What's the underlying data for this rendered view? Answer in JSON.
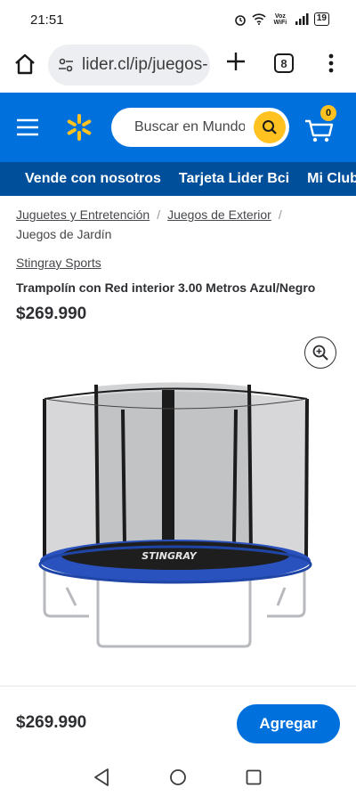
{
  "status_bar": {
    "time": "21:51",
    "network_label": "Voz WiFi",
    "battery": "19"
  },
  "browser": {
    "url": "lider.cl/ip/juegos-",
    "tab_count": "8"
  },
  "header": {
    "search_placeholder": "Buscar en Mundo Lider",
    "cart_count": "0"
  },
  "sub_nav": {
    "items": [
      "Vende con nosotros",
      "Tarjeta Lider Bci",
      "Mi Club"
    ]
  },
  "breadcrumbs": {
    "items": [
      "Juguetes y Entretención",
      "Juegos de Exterior",
      "Juegos de Jardín"
    ]
  },
  "product": {
    "brand": "Stingray Sports",
    "title": "Trampolín con Red interior 3.00 Metros Azul/Negro",
    "price": "$269.990",
    "image_label": "STINGRAY"
  },
  "bottom_bar": {
    "price": "$269.990",
    "add_label": "Agregar"
  },
  "colors": {
    "brand_blue": "#0071dc",
    "sub_nav_blue": "#004f9a",
    "spark_yellow": "#ffc220",
    "trampoline_blue": "#2a52be"
  },
  "icons": [
    "home-icon",
    "tune-icon",
    "plus-icon",
    "tabs-icon",
    "more-vert-icon",
    "hamburger-icon",
    "spark-logo-icon",
    "search-icon",
    "cart-icon",
    "zoom-in-icon",
    "nav-back-icon",
    "nav-home-icon",
    "nav-recents-icon"
  ]
}
